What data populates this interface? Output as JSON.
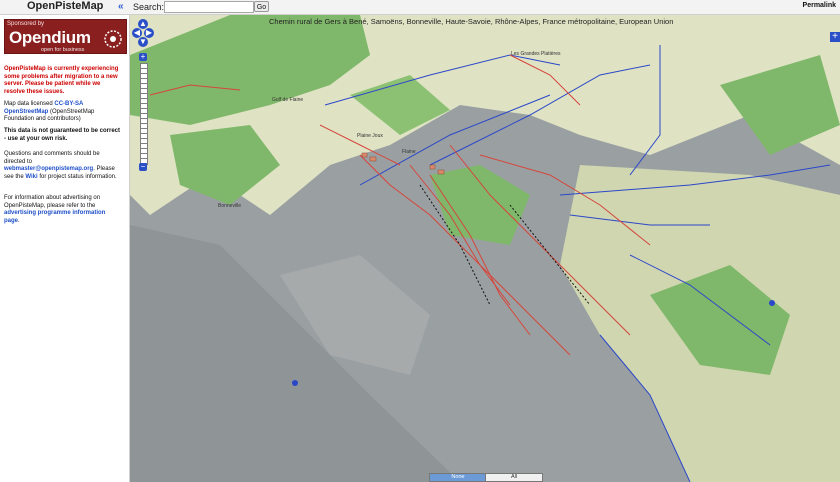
{
  "header": {
    "title": "OpenPisteMap",
    "search_label": "Search:",
    "search_value": "",
    "go_label": "Go",
    "permalink_label": "Permalink"
  },
  "sidebar": {
    "sponsor_label": "Sponsored by",
    "sponsor_name": "Opendium",
    "sponsor_tagline": "open for business",
    "notice": "OpenPisteMap is currently experiencing some problems after migration to a new server. Please be patient while we resolve these issues.",
    "license_prefix": "Map data licensed",
    "license_link": "CC-BY-SA",
    "license_org_link": "OpenStreetMap",
    "license_suffix": "(OpenStreetMap Foundation and contributors)",
    "warning": "This data is not guaranteed to be correct - use at your own risk.",
    "questions_prefix": "Questions and comments should be directed to",
    "email_link": "webmaster@openpistemap.org",
    "questions_mid": "Please see the",
    "wiki_link": "Wiki",
    "questions_suffix": "for project status information.",
    "advert_prefix": "For information about advertising on OpenPisteMap, please refer to the",
    "advert_link": "advertising programme information page"
  },
  "map": {
    "caption": "Chemin rural de Gers à Bené, Samoëns, Bonneville, Haute-Savoie, Rhône-Alpes, France métropolitaine, European Union",
    "labels": [
      "Golf de Flaine",
      "Les Grandes Platières",
      "Plaine Joux",
      "Flaine",
      "Bonneville"
    ],
    "scale_none_label": "None",
    "scale_all_label": "All",
    "colors": {
      "terrain_light": "#dfe3c4",
      "terrain_green": "#7fb86a",
      "piste_red": "#d6453b",
      "lift_blue": "#2b47c9",
      "rock": "#8f9496"
    }
  }
}
